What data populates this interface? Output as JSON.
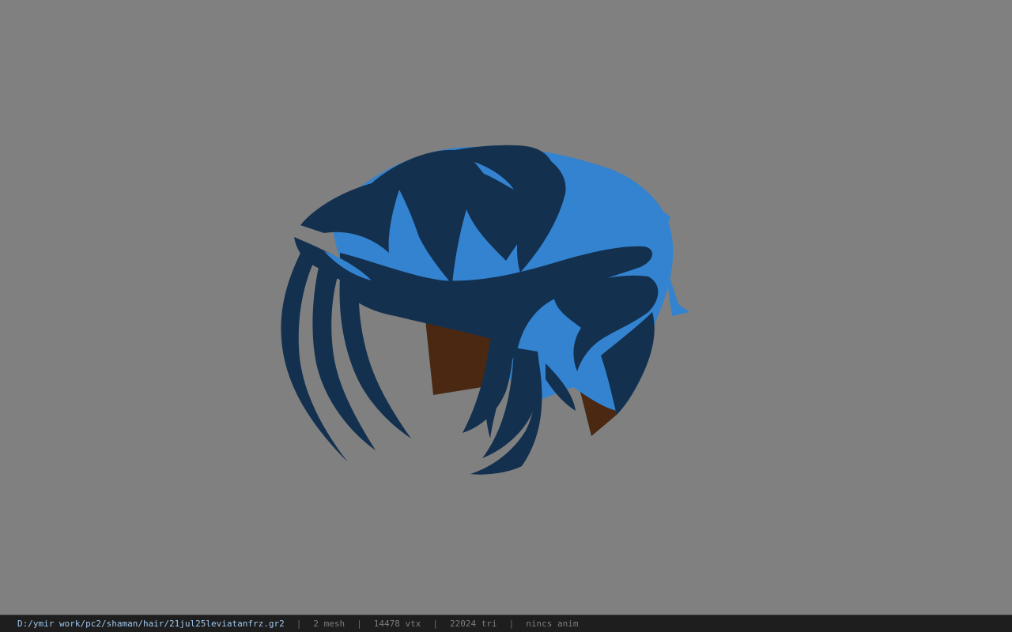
{
  "viewport": {
    "background_color": "#808080",
    "model": {
      "description_icon": "hair-mesh-model",
      "colors": {
        "hair_light": "#3383d0",
        "hair_dark": "#13304f",
        "scalp": "#4a2812"
      }
    }
  },
  "statusbar": {
    "file_path": "D:/ymir work/pc2/shaman/hair/21jul25leviatanfrz.gr2",
    "separator": "|",
    "mesh_count": "2 mesh",
    "vertex_count": "14478 vtx",
    "triangle_count": "22024 tri",
    "anim_status": "nincs anim"
  }
}
